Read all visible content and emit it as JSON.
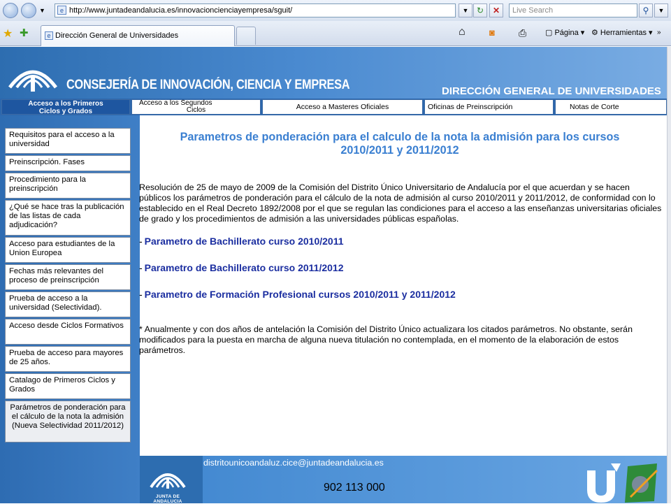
{
  "browser": {
    "url": "http://www.juntadeandalucia.es/innovacioncienciayempresa/sguit/",
    "search_placeholder": "Live Search",
    "tab_title": "Dirección General de Universidades",
    "tools": {
      "page": "Página",
      "tools": "Herramientas"
    }
  },
  "banner": {
    "consejeria": "CONSEJERÍA DE INNOVACIÓN, CIENCIA Y EMPRESA",
    "direccion": "DIRECCIÓN GENERAL DE UNIVERSIDADES"
  },
  "nav_tabs": [
    {
      "line1": "Acceso a los Primeros",
      "line2": "Ciclos y Grados"
    },
    {
      "line1": "Acceso a los Segundos",
      "line2": "Ciclos"
    },
    {
      "label": "Acceso a Masteres Oficiales"
    },
    {
      "label": "Oficinas de Preinscripción"
    },
    {
      "label": "Notas de Corte"
    }
  ],
  "menu": [
    "Requisitos para el acceso a la universidad",
    "Preinscripción. Fases",
    "Procedimiento para la preinscripción",
    "¿Qué se hace tras la publicación de las listas de cada adjudicación?",
    "Acceso para estudiantes de la Union Europea",
    "Fechas más relevantes del proceso de preinscripción",
    "Prueba de acceso a la universidad (Selectividad).",
    "Acceso desde Ciclos Formativos",
    "Prueba de acceso para mayores de 25 años.",
    "Catalago de Primeros Ciclos y Grados",
    "Parámetros de ponderación para el cálculo de la nota la admisión (Nueva Selectividad 2011/2012)"
  ],
  "content": {
    "title_line1": "Parametros de ponderación para el calculo de la nota la admisión para los cursos",
    "title_line2": "2010/2011 y 2011/2012",
    "intro": "Resolución de 25 de mayo de 2009 de la Comisión del Distrito Único Universitario de Andalucía por el que acuerdan y se hacen públicos los parámetros de ponderación para el cálculo de la nota de admisión al curso 2010/2011 y 2011/2012, de conformidad con lo establecido en el Real Decreto 1892/2008 por el que se regulan las condiciones para el acceso a las enseñanzas universitarias oficiales de grado y los procedimientos de admisión a las universidades públicas españolas.",
    "links": [
      "Parametro de Bachillerato curso 2010/2011",
      "Parametro de Bachillerato curso 2011/2012",
      "Parametro de Formación Profesional cursos 2010/2011 y 2011/2012"
    ],
    "link_bullet": "-",
    "note": "* Anualmente y con dos años de antelación la Comisión del Distrito Único actualizara los citados parámetros. No obstante, serán modificados para la puesta en marcha de alguna nueva titulación no contemplada, en el momento de la elaboración de estos parámetros."
  },
  "footer": {
    "email": "distritounicoandaluz.cice@juntadeandalucia.es",
    "phone": "902 113 000",
    "junta_logo_text": "JUNTA DE ANDALUCIA"
  },
  "colors": {
    "banner": "#3f7fc6",
    "title": "#3a7fd1",
    "link": "#1b2ea0"
  }
}
